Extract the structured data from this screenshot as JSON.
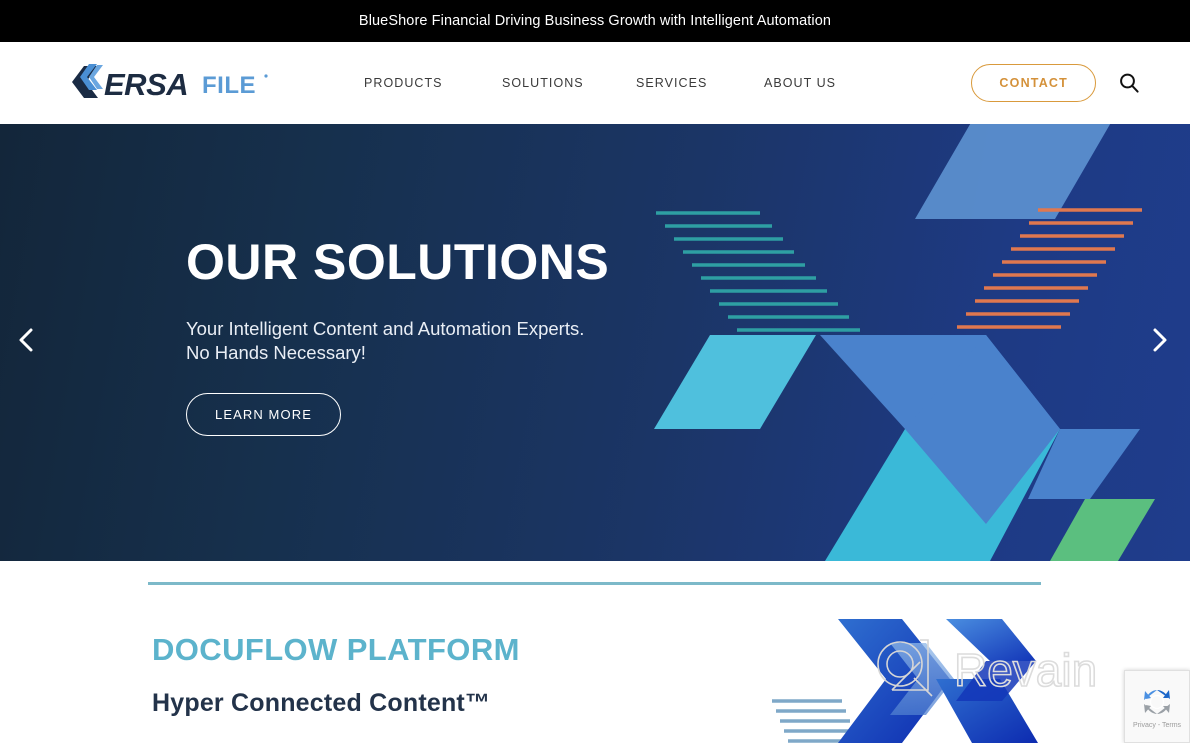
{
  "banner": {
    "text": "BlueShore Financial Driving Business Growth with Intelligent Automation"
  },
  "header": {
    "logo_text_dark": "VERSA",
    "logo_text_light": "FILE",
    "logo_name": "versafile-logo",
    "nav": [
      {
        "label": "PRODUCTS",
        "name": "nav-products"
      },
      {
        "label": "SOLUTIONS",
        "name": "nav-solutions"
      },
      {
        "label": "SERVICES",
        "name": "nav-services"
      },
      {
        "label": "ABOUT US",
        "name": "nav-about-us"
      }
    ],
    "contact_label": "CONTACT",
    "search_icon": "search-icon"
  },
  "hero": {
    "title": "OUR SOLUTIONS",
    "subtitle_line1": "Your Intelligent Content and Automation Experts.",
    "subtitle_line2": "No Hands Necessary!",
    "cta_label": "LEARN MORE",
    "prev_icon": "chevron-left-icon",
    "next_icon": "chevron-right-icon",
    "colors": {
      "gradient_start": "#13263a",
      "gradient_end": "#1f3d8c",
      "cyan": "#4fc0dd",
      "light_blue": "#5b8fd4",
      "mid_blue": "#4a82cc",
      "green": "#5bbf7f",
      "teal_lines": "#2e9fa3",
      "orange_lines": "#e0784f"
    }
  },
  "lower": {
    "section_title": "DOCUFLOW PLATFORM",
    "section_subtitle": "Hyper Connected Content™",
    "divider_color": "#7cb9c9",
    "title_color": "#5cb3cc"
  },
  "watermark": {
    "text": "Revain",
    "name": "revain-watermark"
  },
  "recaptcha": {
    "legal_text": "Privacy - Terms",
    "icon_name": "recaptcha-icon"
  }
}
